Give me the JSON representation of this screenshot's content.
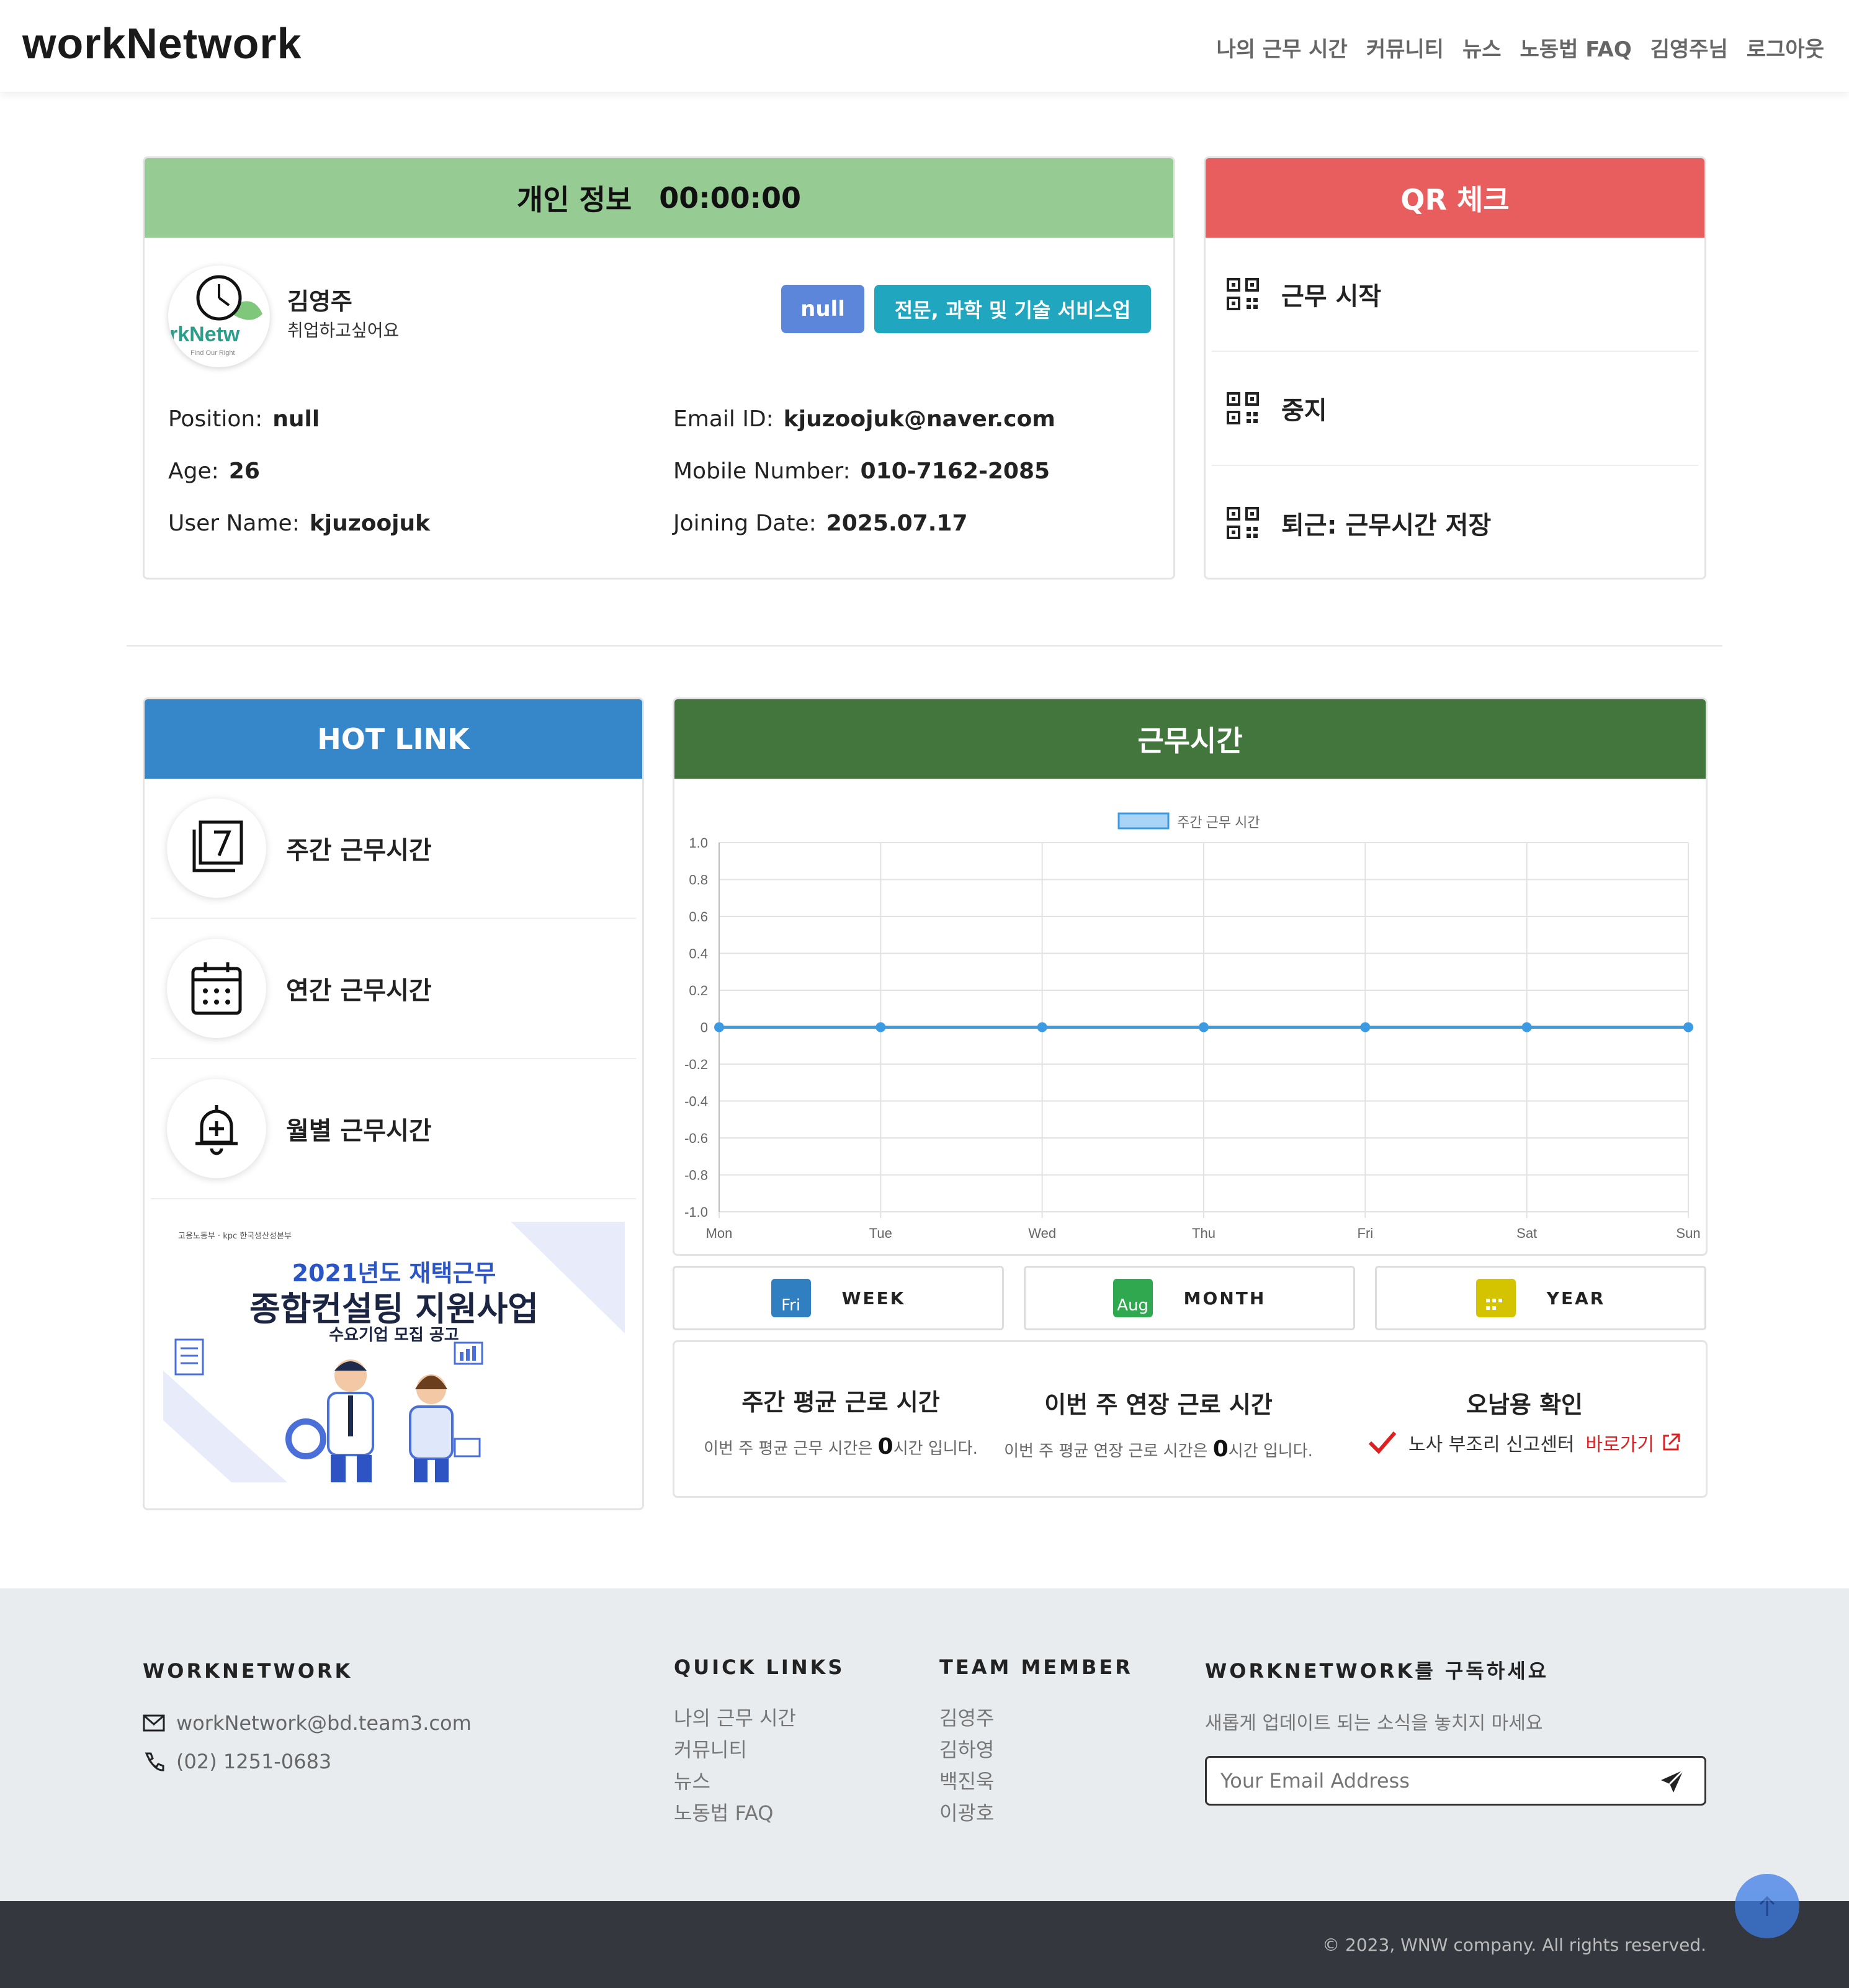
{
  "nav": {
    "logo": "workNetwork",
    "menu": [
      "나의 근무 시간",
      "커뮤니티",
      "뉴스",
      "노동법 FAQ",
      "김영주님",
      "로그아웃"
    ]
  },
  "profile": {
    "header_title": "개인 정보",
    "timer": "00:00:00",
    "avatar_text": "rkNetw",
    "avatar_sub": "Find Our Right",
    "name": "김영주",
    "status": "취업하고싶어요",
    "badge1": "null",
    "badge2": "전문, 과학 및 기술 서비스업",
    "fields": {
      "position_label": "Position:",
      "position": "null",
      "age_label": "Age:",
      "age": "26",
      "username_label": "User Name:",
      "username": "kjuzoojuk",
      "email_label": "Email ID:",
      "email": "kjuzoojuk@naver.com",
      "mobile_label": "Mobile Number:",
      "mobile": "010-7162-2085",
      "joining_label": "Joining Date:",
      "joining": "2025.07.17"
    }
  },
  "qr": {
    "title": "QR 체크",
    "items": [
      "근무 시작",
      "중지",
      "퇴근: 근무시간 저장"
    ]
  },
  "hotlink": {
    "title": "HOT LINK",
    "items": [
      "주간 근무시간",
      "연간 근무시간",
      "월별 근무시간"
    ],
    "banner": {
      "org": "고용노동부 · kpc 한국생산성본부",
      "line1": "2021년도 재택근무",
      "line2": "종합컨설팅 지원사업",
      "line3": "수요기업 모집 공고"
    }
  },
  "worktime": {
    "title": "근무시간",
    "buttons": [
      {
        "label": "WEEK",
        "icon": "Fri",
        "color": "#2f7fc1"
      },
      {
        "label": "MONTH",
        "icon": "Aug",
        "color": "#2fa84f"
      },
      {
        "label": "YEAR",
        "icon": "",
        "color": "#d4c400"
      }
    ],
    "stats": [
      {
        "title": "주간 평균 근로 시간",
        "pre": "이번 주 평균 근무 시간은 ",
        "value": "0",
        "post": "시간 입니다."
      },
      {
        "title": "이번 주 연장 근로 시간",
        "pre": "이번 주 평균 연장 근로 시간은 ",
        "value": "0",
        "post": "시간 입니다."
      }
    ],
    "misuse": {
      "title": "오남용 확인",
      "text": "노사 부조리 신고센터",
      "link": "바로가기"
    }
  },
  "chart_data": {
    "type": "line",
    "categories": [
      "Mon",
      "Tue",
      "Wed",
      "Thu",
      "Fri",
      "Sat",
      "Sun"
    ],
    "series": [
      {
        "name": "주간 근무 시간",
        "values": [
          0,
          0,
          0,
          0,
          0,
          0,
          0
        ]
      }
    ],
    "ylim": [
      -1.0,
      1.0
    ],
    "yticks": [
      "1.0",
      "0.8",
      "0.6",
      "0.4",
      "0.2",
      "0",
      "-0.2",
      "-0.4",
      "-0.6",
      "-0.8",
      "-1.0"
    ],
    "grid": true,
    "legend": "top-center",
    "color": "#3b9ae1"
  },
  "footer": {
    "brand": "WORKNETWORK",
    "email": "workNetwork@bd.team3.com",
    "phone": "(02) 1251-0683",
    "quick_title": "QUICK LINKS",
    "quick": [
      "나의 근무 시간",
      "커뮤니티",
      "뉴스",
      "노동법 FAQ"
    ],
    "team_title": "TEAM MEMBER",
    "team": [
      "김영주",
      "김하영",
      "백진욱",
      "이광호"
    ],
    "sub_title": "WORKNETWORK를 구독하세요",
    "sub_text": "새롭게 업데이트 되는 소식을 놓치지 마세요",
    "sub_placeholder": "Your Email Address",
    "copyright": "© 2023, WNW company. All rights reserved."
  },
  "colors": {
    "green_head": "#97cb94",
    "red_head": "#e85d5d",
    "blue_head": "#3587c9",
    "dark_green": "#43763d"
  }
}
